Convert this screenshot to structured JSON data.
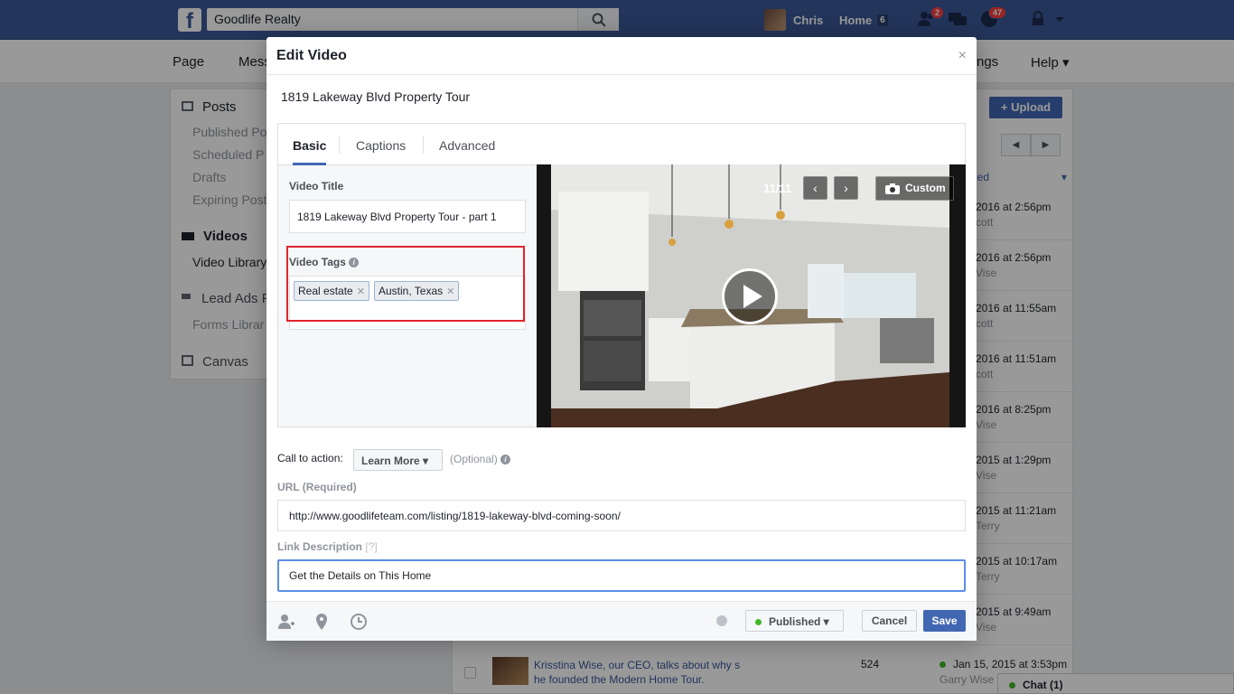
{
  "topbar": {
    "search_value": "Goodlife Realty",
    "user_name": "Chris",
    "home_label": "Home",
    "home_count": "6",
    "friend_requests_badge": "2",
    "notifications_badge": "47"
  },
  "page_nav": {
    "items": [
      "Page",
      "Mess",
      "ngs",
      "Help ▾"
    ]
  },
  "left_sidebar": {
    "posts": "Posts",
    "published": "Published Po",
    "scheduled": "Scheduled P",
    "drafts": "Drafts",
    "expiring": "Expiring Post",
    "videos": "Videos",
    "video_library": "Video Library",
    "lead_ads": "Lead Ads F",
    "forms_library": "Forms Librar",
    "canvas": "Canvas"
  },
  "library": {
    "upload_label": "+ Upload",
    "filter_label": "ded",
    "rows": [
      {
        "date": "2016 at 2:56pm",
        "by": "cott"
      },
      {
        "date": "2016 at 2:56pm",
        "by": "Vise"
      },
      {
        "date": "2016 at 11:55am",
        "by": "cott"
      },
      {
        "date": "2016 at 11:51am",
        "by": "cott"
      },
      {
        "date": "2016 at 8:25pm",
        "by": "Vise"
      },
      {
        "date": "2015 at 1:29pm",
        "by": "Vise"
      },
      {
        "date": "2015 at 11:21am",
        "by": "Terry"
      },
      {
        "date": "2015 at 10:17am",
        "by": "Terry"
      },
      {
        "date": "2015 at 9:49am",
        "by": "Vise"
      }
    ],
    "last_row": {
      "title": "Krisstina Wise, our CEO, talks about why s he founded the Modern Home Tour.",
      "views": "524",
      "date": "Jan 15, 2015 at 3:53pm",
      "by": "Garry Wise"
    },
    "chat_label": "Chat (1)"
  },
  "dialog": {
    "title": "Edit Video",
    "close": "×",
    "video_name": "1819 Lakeway Blvd Property Tour",
    "tabs": [
      "Basic",
      "Captions",
      "Advanced"
    ],
    "video_title_label": "Video Title",
    "video_title_value": "1819 Lakeway Blvd Property Tour - part 1",
    "video_tags_label": "Video Tags",
    "tags": [
      "Real estate",
      "Austin, Texas"
    ],
    "thumb_counter": "11/11",
    "custom_label": "Custom",
    "cta_label": "Call to action:",
    "cta_value": "Learn More ▾",
    "cta_optional": "(Optional)",
    "url_label": "URL (Required)",
    "url_value": "http://www.goodlifeteam.com/listing/1819-lakeway-blvd-coming-soon/",
    "link_desc_label": "Link Description",
    "link_desc_hint": "[?]",
    "link_desc_value": "Get the Details on This Home",
    "published_label": "Published ▾",
    "cancel_label": "Cancel",
    "save_label": "Save"
  },
  "colors": {
    "brand": "#3b5998",
    "button_blue": "#4267b2",
    "highlight_red": "#e0242b",
    "published_green": "#42b72a"
  }
}
